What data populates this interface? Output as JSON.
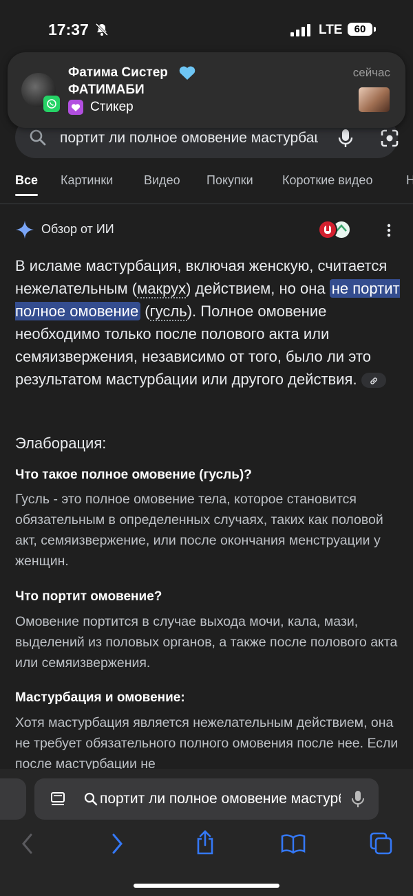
{
  "status_bar": {
    "time": "17:37",
    "network": "LTE",
    "battery": "60"
  },
  "notification": {
    "app": "whatsapp-icon",
    "sender": "Фатима Систер",
    "group": "ФАТИМАБИ",
    "message": "Стикер",
    "time": "сейчас"
  },
  "search": {
    "query": "портит ли полное омовение мастурбация"
  },
  "tabs": [
    "Все",
    "Картинки",
    "Видео",
    "Покупки",
    "Короткие видео",
    "Н"
  ],
  "ai_overview": {
    "title": "Обзор от ИИ",
    "p1_a": "В исламе мастурбация, включая женскую, считается нежелательным (",
    "p1_makruh": "макрух",
    "p1_b": ") действием, но она ",
    "p1_highlight": "не портит полное омовение",
    "p1_c": " (",
    "p1_gusl": "гусль",
    "p1_d": "). Полное омовение необходимо только после полового акта или семяизвержения, независимо от того, было ли это результатом мастурбации или другого действия."
  },
  "elaboration": {
    "heading": "Элаборация:",
    "sections": [
      {
        "title": "Что такое полное омовение (гусль)?",
        "text": "Гусль - это полное омовение тела, которое становится обязательным в определенных случаях, таких как половой акт, семяизвержение, или после окончания менструации у женщин."
      },
      {
        "title": "Что портит омовение?",
        "text": "Омовение портится в случае выхода мочи, кала, мази, выделений из половых органов, а также после полового акта или семяизвержения."
      },
      {
        "title": "Мастурбация и омовение:",
        "text": "Хотя мастурбация является нежелательным действием, она не требует обязательного полного омовения после нее. Если после мастурбации не"
      }
    ]
  },
  "safari": {
    "address": "портит ли полное омовение мастурбация"
  }
}
